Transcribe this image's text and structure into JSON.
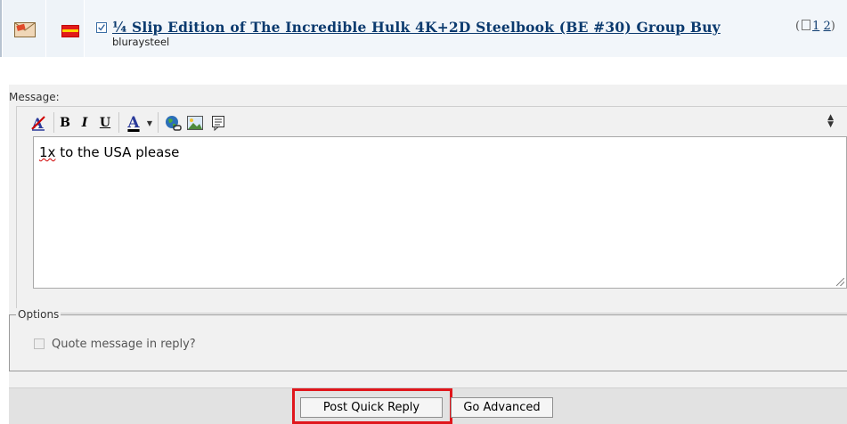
{
  "thread": {
    "title": "¼ Slip Edition of The Incredible Hulk 4K+2D Steelbook (BE #30) Group Buy",
    "pages_prefix": "(",
    "page_links": [
      "1",
      "2"
    ],
    "pages_suffix": ")",
    "author": "bluraysteel",
    "icons": [
      "envelope-icon",
      "flag-icon",
      "checkbox-icon",
      "multipage-icon"
    ]
  },
  "message": {
    "label": "Message:",
    "text_misspelled": "1x",
    "text_rest": " to the USA please",
    "toolbar": {
      "bold": "B",
      "italic": "I",
      "underline": "U",
      "text_color": "A",
      "buttons": [
        "remove-format",
        "bold",
        "italic",
        "underline",
        "text-color",
        "insert-link",
        "insert-image",
        "wrap-quote",
        "resize-toggle"
      ]
    }
  },
  "options": {
    "legend": "Options",
    "quote_label": "Quote message in reply?",
    "quote_checked": false
  },
  "buttons": {
    "post_quick_reply": "Post Quick Reply",
    "go_advanced": "Go Advanced"
  },
  "colors": {
    "link": "#0b3a6e",
    "highlight": "#e0161c",
    "panel_bg": "#f1f1f1",
    "footer_bg": "#e2e2e2"
  }
}
